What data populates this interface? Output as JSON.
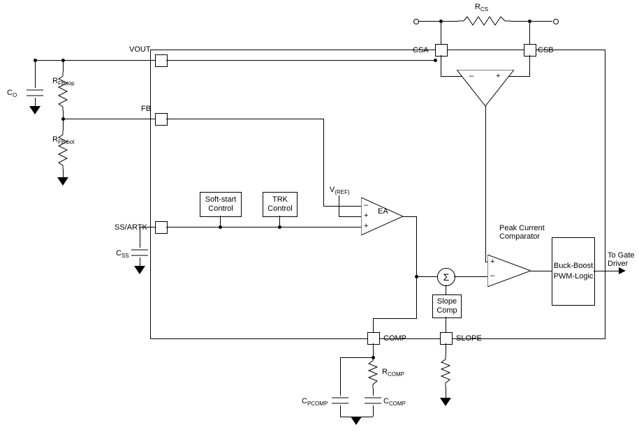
{
  "pins": {
    "vout": "VOUT",
    "fb": "FB",
    "ssartk": "SS/ARTK",
    "csa": "CSA",
    "csb": "CSB",
    "comp": "COMP",
    "slope": "SLOPE"
  },
  "labels": {
    "co": "C",
    "co_sub": "O",
    "rfbtop": "R",
    "rfbtop_sub": "FB,top",
    "rfbbot": "R",
    "rfbbot_sub": "FB,bot",
    "css": "C",
    "css_sub": "SS",
    "rcs": "R",
    "rcs_sub": "CS",
    "vref": "V",
    "vref_sub": "(REF)",
    "rcomp": "R",
    "rcomp_sub": "COMP",
    "ccomp": "C",
    "ccomp_sub": "COMP",
    "cpcomp": "C",
    "cpcomp_sub": "PCOMP",
    "to_gate": "To Gate Driver",
    "ea": "EA",
    "peakcurrent": "Peak Current Comparator",
    "sum": "Σ"
  },
  "blocks": {
    "softstart": "Soft-start Control",
    "trk": "TRK Control",
    "slopecomp": "Slope Comp",
    "pwmlogic": "Buck-Boost PWM-Logic"
  },
  "signs": {
    "plus": "+",
    "minus": "–"
  }
}
